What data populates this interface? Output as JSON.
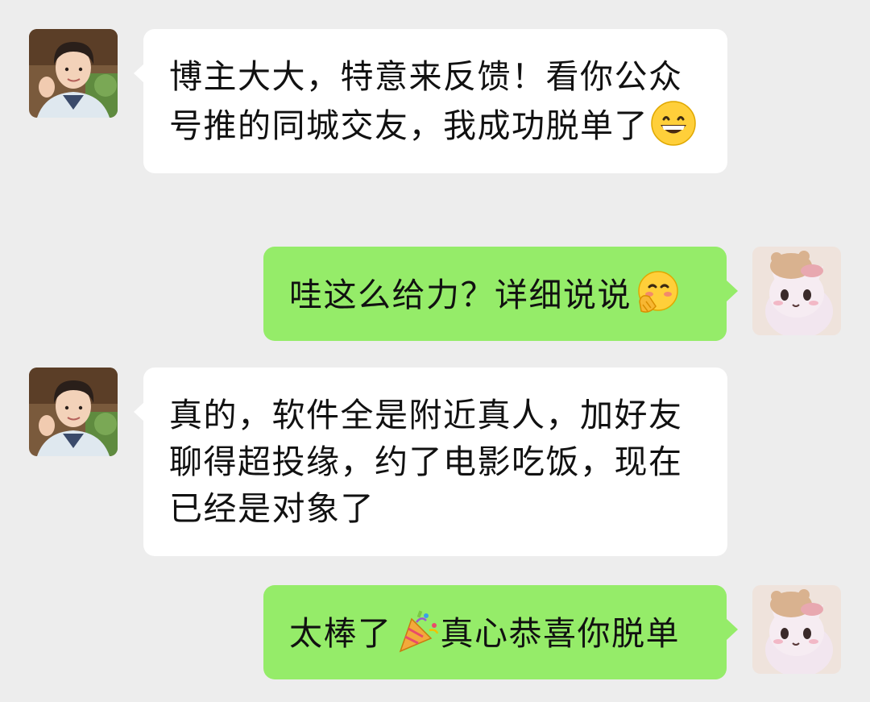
{
  "chat": {
    "messages": [
      {
        "sender": "other",
        "avatar_icon": "young-man-avatar",
        "text": "博主大大，特意来反馈！看你公众号推的同城交友，我成功脱单了",
        "emoji": "grinning-face-emoji"
      },
      {
        "sender": "self",
        "avatar_icon": "plush-cat-avatar",
        "text": "哇这么给力？详细说说",
        "emoji": "face-with-hand-over-mouth-emoji"
      },
      {
        "sender": "other",
        "avatar_icon": "young-man-avatar",
        "text": "真的，软件全是附近真人，加好友聊得超投缘，约了电影吃饭，现在已经是对象了"
      },
      {
        "sender": "self",
        "avatar_icon": "plush-cat-avatar",
        "text_before": "太棒了",
        "emoji": "party-popper-emoji",
        "text_after": "真心恭喜你脱单"
      }
    ]
  },
  "colors": {
    "background": "#ededed",
    "incoming_bubble": "#ffffff",
    "outgoing_bubble": "#95ec69",
    "text": "#111111"
  }
}
